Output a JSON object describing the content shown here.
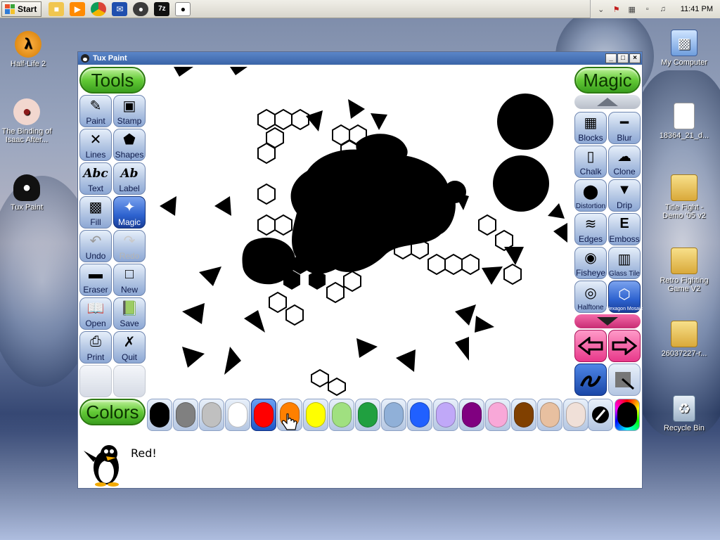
{
  "taskbar": {
    "start_label": "Start",
    "quick_launch": [
      "folder-icon",
      "media-player-icon",
      "chrome-icon",
      "mail-icon",
      "winamp-icon",
      "7zip-icon",
      "tux-icon"
    ],
    "clock": "11:41 PM"
  },
  "desktop": {
    "icons": [
      {
        "label": "Half-Life 2"
      },
      {
        "label": "The Binding of Isaac After..."
      },
      {
        "label": "Tux Paint"
      },
      {
        "label": "My Computer"
      },
      {
        "label": "18364_21_d..."
      },
      {
        "label": "Title Fight - Demo '05 v2"
      },
      {
        "label": "Retro Fighting Game V2"
      },
      {
        "label": "26037227-r..."
      },
      {
        "label": "Recycle Bin"
      }
    ]
  },
  "window": {
    "title": "Tux Paint",
    "controls": {
      "minimize": "_",
      "maximize": "□",
      "close": "×"
    }
  },
  "tuxpaint": {
    "tools_title": "Tools",
    "magic_title": "Magic",
    "colors_title": "Colors",
    "tools": [
      {
        "label": "Paint"
      },
      {
        "label": "Stamp"
      },
      {
        "label": "Lines"
      },
      {
        "label": "Shapes"
      },
      {
        "label": "Text"
      },
      {
        "label": "Label"
      },
      {
        "label": "Fill"
      },
      {
        "label": "Magic"
      },
      {
        "label": "Undo"
      },
      {
        "label": "Redo"
      },
      {
        "label": "Eraser"
      },
      {
        "label": "New"
      },
      {
        "label": "Open"
      },
      {
        "label": "Save"
      },
      {
        "label": "Print"
      },
      {
        "label": "Quit"
      }
    ],
    "tool_icons": {
      "text": "Abc",
      "label": "Ab"
    },
    "magic": [
      {
        "label": "Blocks"
      },
      {
        "label": "Blur"
      },
      {
        "label": "Chalk"
      },
      {
        "label": "Clone"
      },
      {
        "label": "Distortion"
      },
      {
        "label": "Drip"
      },
      {
        "label": "Edges"
      },
      {
        "label": "Emboss"
      },
      {
        "label": "Fisheye"
      },
      {
        "label": "Glass Tile"
      },
      {
        "label": "Halftone"
      },
      {
        "label": "Hexagon Mosaic"
      }
    ],
    "colors": [
      "#000000",
      "#808080",
      "#c0c0c0",
      "#ffffff",
      "#ff0000",
      "#ff8000",
      "#ffff00",
      "#a0e080",
      "#20a040",
      "#90b0d8",
      "#2060ff",
      "#c0a8f8",
      "#800080",
      "#f8a8d8",
      "#804000",
      "#e8c0a0",
      "#f0e0d8"
    ],
    "selected_color_index": 4,
    "status_text": "Red!"
  }
}
